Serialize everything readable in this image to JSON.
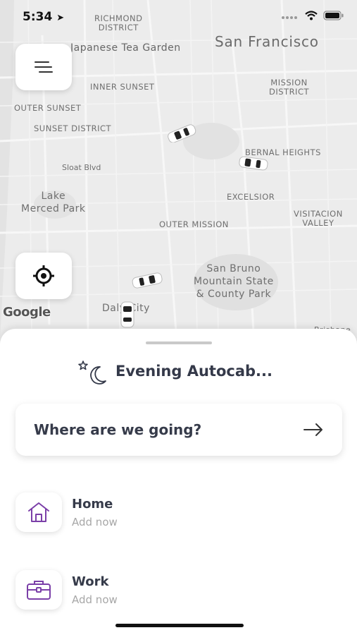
{
  "status_bar": {
    "time": "5:34"
  },
  "map": {
    "labels": {
      "richmond": "RICHMOND\nDISTRICT",
      "tea_garden": "Japanese Tea Garden",
      "san_francisco": "San Francisco",
      "inner_sunset": "INNER SUNSET",
      "mission": "MISSION\nDISTRICT",
      "outer_sunset": "OUTER SUNSET",
      "sunset_district": "SUNSET DISTRICT",
      "bernal": "BERNAL HEIGHTS",
      "sloat": "Sloat Blvd",
      "lake_merced": "Lake\nMerced Park",
      "excelsior": "EXCELSIOR",
      "visitacion": "VISITACION\nVALLEY",
      "outer_mission": "OUTER MISSION",
      "san_bruno": "San Bruno\nMountain State\n& County Park",
      "daly_city": "Daly City",
      "brisbane": "Brisbane"
    },
    "google_logo": "Google"
  },
  "sheet": {
    "greeting": "Evening Autocab...",
    "search_placeholder": "Where are we going?",
    "places": [
      {
        "title": "Home",
        "subtitle": "Add now"
      },
      {
        "title": "Work",
        "subtitle": "Add now"
      }
    ]
  },
  "colors": {
    "accent": "#7b3fa8",
    "map_bg": "#ececec"
  }
}
